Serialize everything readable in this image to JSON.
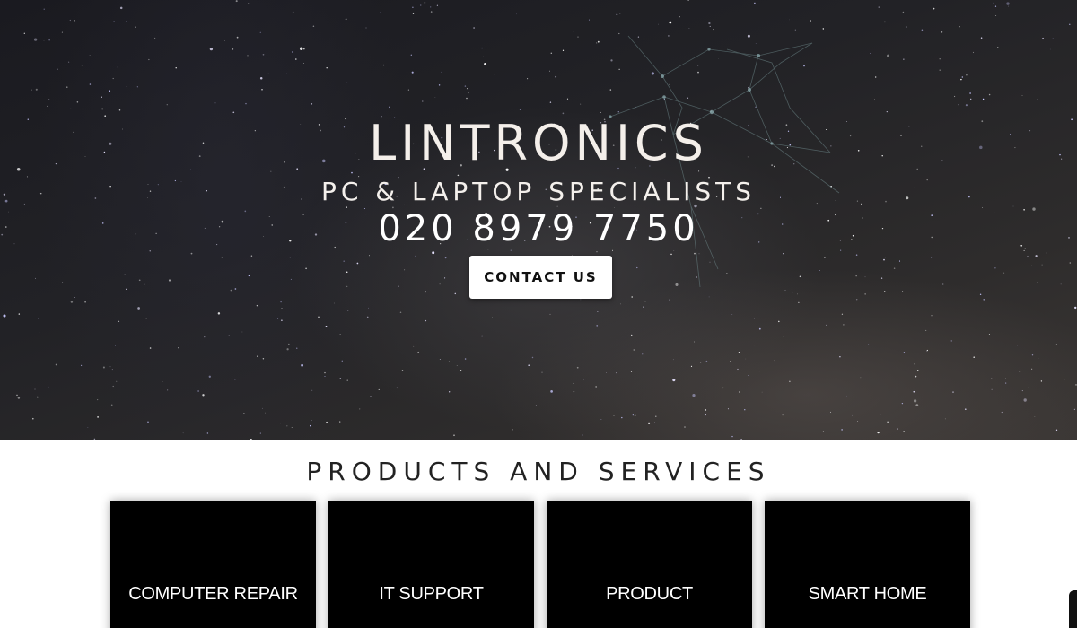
{
  "hero": {
    "title": "LINTRONICS",
    "tagline": "PC & LAPTOP SPECIALISTS",
    "phone": "020 8979 7750",
    "contact_button_label": "CONTACT US"
  },
  "products": {
    "heading": "PRODUCTS AND SERVICES",
    "cards": [
      {
        "label": "COMPUTER REPAIR"
      },
      {
        "label": "IT SUPPORT"
      },
      {
        "label": "PRODUCT"
      },
      {
        "label": "SMART HOME"
      }
    ]
  },
  "colors": {
    "card_background": "#000000",
    "button_background": "#ffffff",
    "hero_text": "#f4efea"
  }
}
